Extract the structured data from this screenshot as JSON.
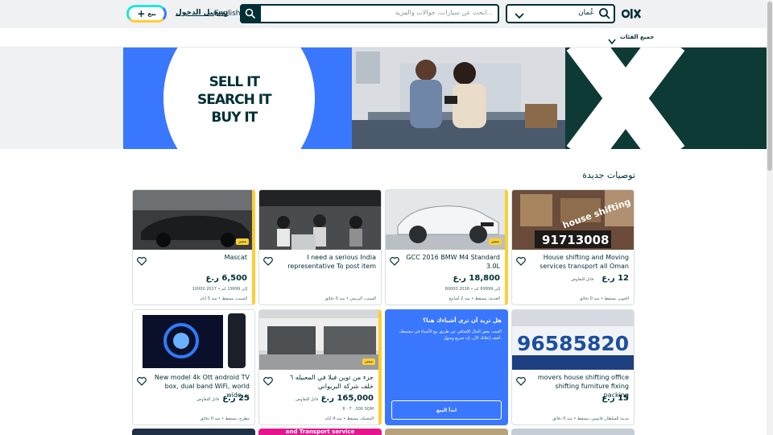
{
  "header": {
    "location_text": "عُمان",
    "search_placeholder": "ابحث عن سيارات، جوالات والمزيد...",
    "language": "English",
    "login": "تسجيل الدخول",
    "sell_label": "بيع",
    "sell_plus": "+"
  },
  "categories": {
    "all_label": "جميع الفئات"
  },
  "banner": {
    "line1": "SELL IT",
    "line2": "SEARCH IT",
    "line3": "BUY IT"
  },
  "section": {
    "title": "توصيات جديدة"
  },
  "badge_label": "مميز",
  "cards": [
    {
      "title": "House shifting and Moving services transport all Oman",
      "price": "12 ر.ع",
      "negotiable": "قابل للتفاوض",
      "meta": "",
      "location": "الخوير، مسقط • منذ 0 دقائق"
    },
    {
      "title": "GCC 2016 BMW M4 Standard 3.0L",
      "price": "18,800 ر.ع",
      "negotiable": "",
      "meta": "60000 إلى 69999 كم • 2016",
      "location": "العذيبة، مسقط • منذ 2 أسابيع"
    },
    {
      "title": "I need a serious India representative To post item",
      "price": "",
      "negotiable": "",
      "meta": "",
      "location": "السيب، البريمي • منذ 0 دقائق"
    },
    {
      "title": "Mascat",
      "price": "6,500 ر.ع",
      "negotiable": "",
      "meta": "10000 إلى 19999 كم • 2017",
      "location": "السيب، مسقط • منذ 5 أيام"
    },
    {
      "title": "movers house shifting office shifting furniture fixing packing",
      "price": "15 ر.ع",
      "negotiable": "",
      "meta": "",
      "location": "مدينة السلطان قابوس، مسقط • منذ 0 دقائق"
    },
    {
      "title": "جزء من توين فيلا في المعبيله ٦ خلف شركة البريواني",
      "price": "165,000 ر.ع",
      "negotiable": "قابل للتفاوض",
      "meta": "6 · 7 · 300 SQM",
      "location": "المعبيلة، مسقط • منذ 4 أيام"
    },
    {
      "title": "New model 4k Ott android TV box, dual band WiFi, world wide ...",
      "price": "25 ر.ع",
      "negotiable": "قابل للتفاوض",
      "meta": "",
      "location": "مطرح، مسقط • منذ 0 دقائق"
    }
  ],
  "card_image_texts": {
    "house_tag": "house shifting",
    "house_phone": "91713008",
    "movers_phone": "96585820"
  },
  "promo": {
    "title": "هل تريد أن ترى أشياءك هنا؟",
    "body": "اكسب بعض المال الإضافي عن طريق بيع الأشياء في مجتمعك. أضف إعلانك الآن، إنه سريع وسهل.",
    "button": "ابدأ البيع"
  },
  "bottom_strip_text": "and Transport service",
  "colors": {
    "brand_dark": "#002f34",
    "brand_blue": "#3a77ff",
    "featured_yellow": "#ffce32",
    "teal": "#23e5db",
    "pink_strip": "#e5168d"
  }
}
